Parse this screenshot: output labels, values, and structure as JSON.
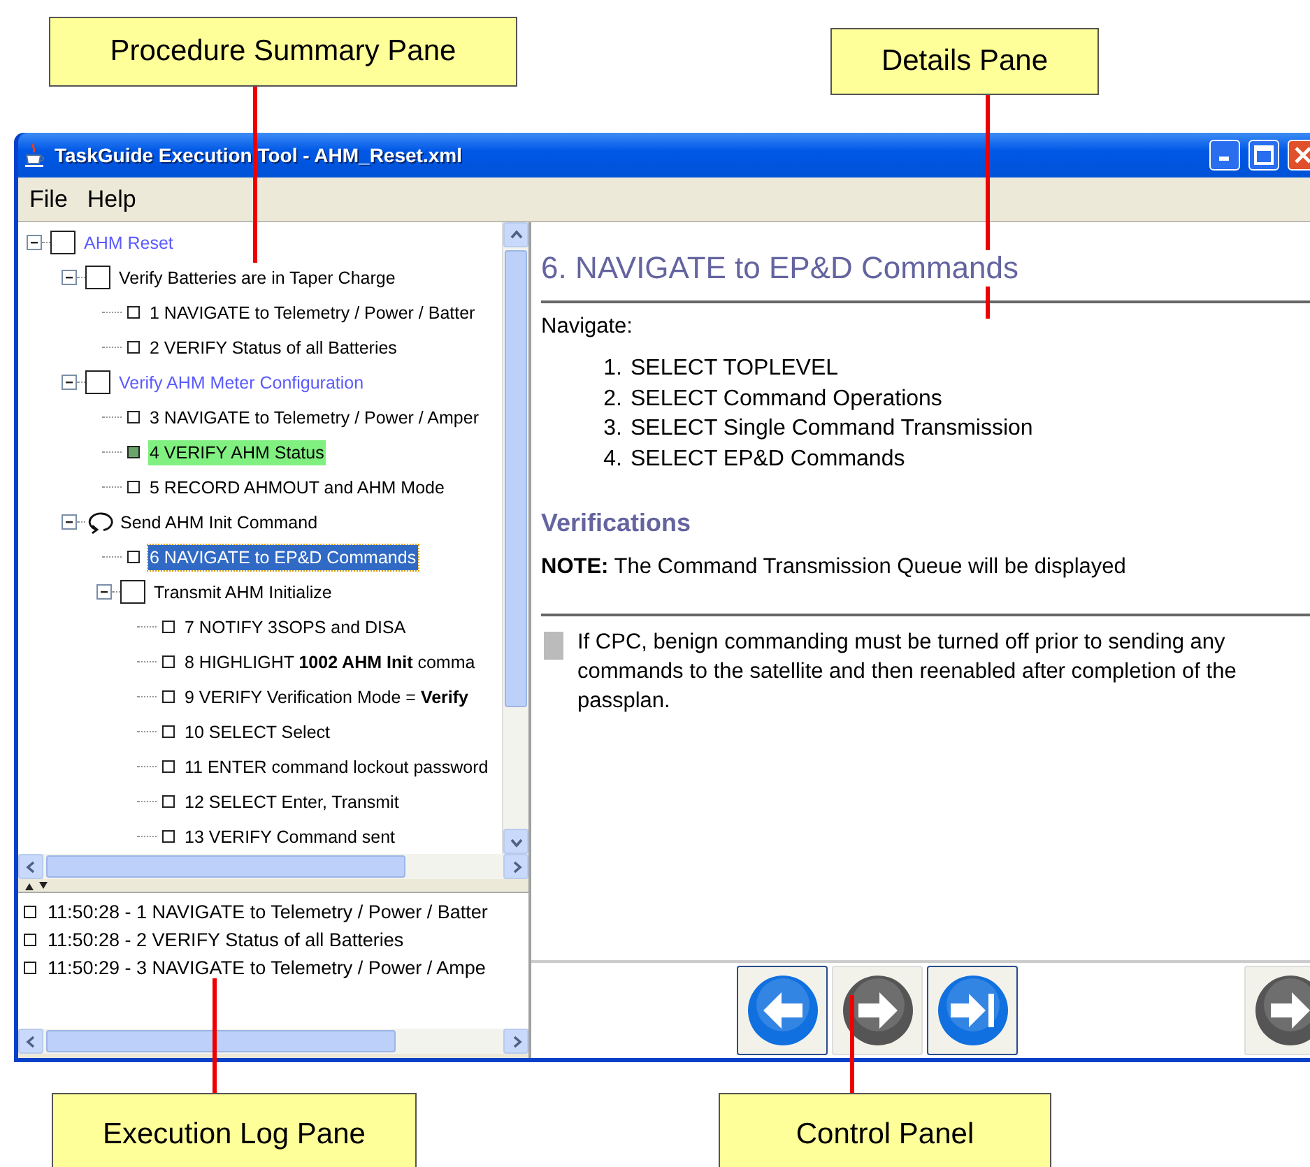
{
  "callouts": {
    "top": [
      {
        "label": "Procedure Summary Pane"
      },
      {
        "label": "Details Pane"
      }
    ],
    "bottom": [
      {
        "label": "Execution Log Pane"
      },
      {
        "label": "Control Panel"
      }
    ]
  },
  "window": {
    "title": "TaskGuide Execution Tool - AHM_Reset.xml"
  },
  "menu": [
    "File",
    "Help"
  ],
  "tree": [
    {
      "label": "AHM Reset",
      "kind": "group",
      "checked": false,
      "active": true,
      "selected": false,
      "expanded": true,
      "children": [
        {
          "label": "Verify Batteries are in Taper Charge",
          "kind": "group",
          "checked": false,
          "active": false,
          "selected": false,
          "expanded": true,
          "children": [
            {
              "label": "1 NAVIGATE to Telemetry / Power / Batter",
              "kind": "step",
              "checked": false,
              "selected": false
            },
            {
              "label": "2 VERIFY Status of all Batteries",
              "kind": "step",
              "checked": false,
              "selected": false
            }
          ]
        },
        {
          "label": "Verify AHM Meter Configuration",
          "kind": "group",
          "checked": false,
          "active": true,
          "selected": false,
          "expanded": true,
          "children": [
            {
              "label": "3 NAVIGATE to Telemetry / Power / Amper",
              "kind": "step",
              "checked": false,
              "selected": false
            },
            {
              "label": "4 VERIFY AHM Status",
              "kind": "step",
              "checked": true,
              "selected": false
            },
            {
              "label": "5 RECORD AHMOUT and AHM Mode",
              "kind": "step",
              "checked": false,
              "selected": false
            }
          ]
        },
        {
          "label": "Send AHM Init Command",
          "kind": "loop",
          "active": false,
          "selected": false,
          "expanded": true,
          "children": [
            {
              "label": "6 NAVIGATE to EP&D Commands",
              "kind": "step",
              "checked": false,
              "selected": true
            },
            {
              "label": "Transmit AHM Initialize",
              "kind": "group",
              "checked": false,
              "active": false,
              "selected": false,
              "expanded": true,
              "children": [
                {
                  "label": "7 NOTIFY 3SOPS and DISA",
                  "kind": "step",
                  "checked": false,
                  "selected": false
                },
                {
                  "label": "8 HIGHLIGHT **1002 AHM Init** comma",
                  "kind": "step",
                  "checked": false,
                  "selected": false
                },
                {
                  "label": "9 VERIFY Verification Mode = **Verify**",
                  "kind": "step",
                  "checked": false,
                  "selected": false
                },
                {
                  "label": "10 SELECT Select",
                  "kind": "step",
                  "checked": false,
                  "selected": false
                },
                {
                  "label": "11 ENTER command lockout password",
                  "kind": "step",
                  "checked": false,
                  "selected": false
                },
                {
                  "label": "12 SELECT Enter, Transmit",
                  "kind": "step",
                  "checked": false,
                  "selected": false
                },
                {
                  "label": "13 VERIFY Command sent",
                  "kind": "step",
                  "checked": false,
                  "selected": false
                }
              ]
            }
          ]
        }
      ]
    }
  ],
  "log": [
    {
      "text": "11:50:28 - 1 NAVIGATE to Telemetry / Power / Batter",
      "checked": false
    },
    {
      "text": "11:50:28 - 2 VERIFY Status of all Batteries",
      "checked": false
    },
    {
      "text": "11:50:29 - 3 NAVIGATE to Telemetry / Power / Ampe",
      "checked": false
    }
  ],
  "details": {
    "title": "6. NAVIGATE to EP&D Commands",
    "intro": "Navigate:",
    "steps": [
      {
        "number": "1.",
        "text": "SELECT TOPLEVEL"
      },
      {
        "number": "2.",
        "text": "SELECT Command Operations"
      },
      {
        "number": "3.",
        "text": "SELECT Single Command Transmission"
      },
      {
        "number": "4.",
        "text": "SELECT EP&D Commands"
      }
    ],
    "verifications_heading": "Verifications",
    "note": "**NOTE:** The Command Transmission Queue will be displayed",
    "remark": "If CPC, benign commanding must be turned off prior to sending any commands to the satellite and then reenabled after completion of the passplan."
  },
  "controls": [
    {
      "kind": "back",
      "disabled": false
    },
    {
      "kind": "next",
      "disabled": true
    },
    {
      "kind": "skip",
      "disabled": false
    },
    {
      "kind": "next",
      "disabled": true
    }
  ]
}
